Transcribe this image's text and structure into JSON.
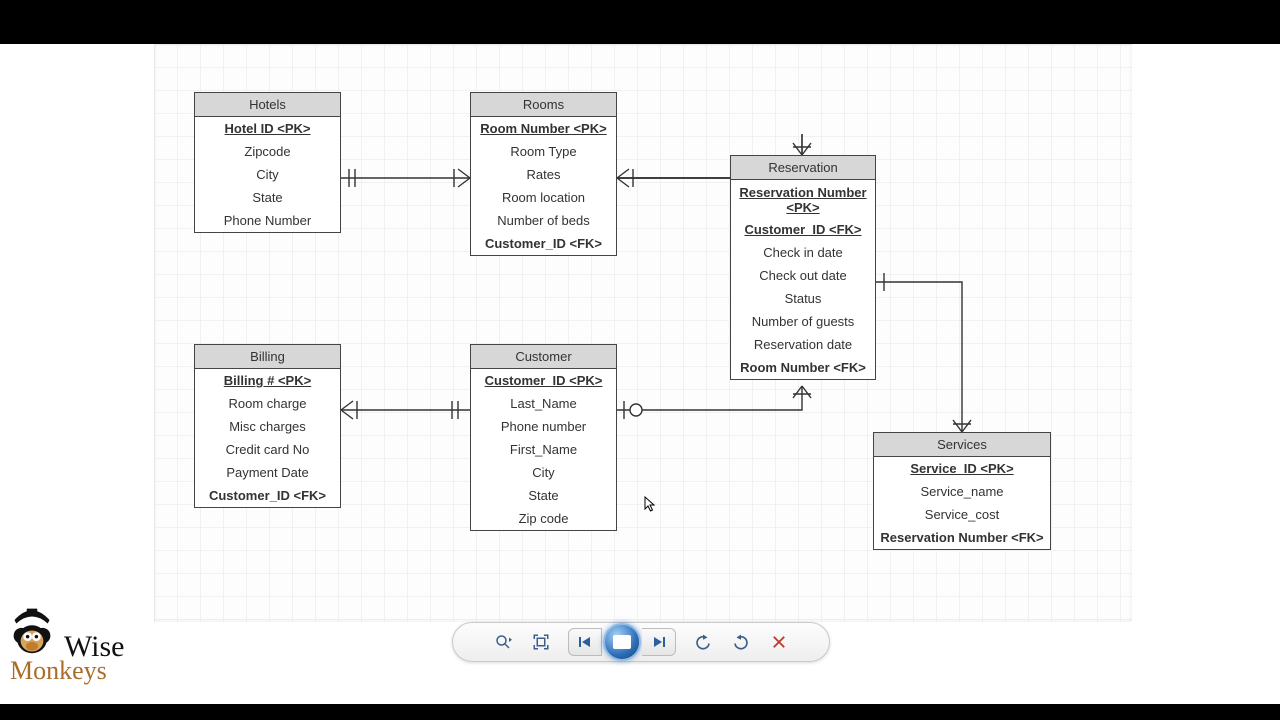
{
  "logo": {
    "line1": "Wise",
    "line2": "Monkeys"
  },
  "entities": {
    "hotels": {
      "title": "Hotels",
      "pk": "Hotel ID <PK>",
      "rows": [
        "Zipcode",
        "City",
        "State",
        "Phone Number"
      ]
    },
    "rooms": {
      "title": "Rooms",
      "pk": "Room Number <PK>",
      "rows": [
        "Room Type",
        "Rates",
        "Room location",
        "Number of beds"
      ],
      "fk": "Customer_ID <FK>"
    },
    "reservation": {
      "title": "Reservation",
      "pk1": "Reservation Number <PK>",
      "pk2": "Customer_ID <FK>",
      "rows": [
        "Check in date",
        "Check out date",
        "Status",
        "Number of guests",
        "Reservation date"
      ],
      "fk": "Room Number <FK>"
    },
    "billing": {
      "title": "Billing",
      "pk": "Billing # <PK>",
      "rows": [
        "Room charge",
        "Misc charges",
        "Credit card No",
        "Payment Date"
      ],
      "fk": "Customer_ID <FK>"
    },
    "customer": {
      "title": "Customer",
      "pk": "Customer_ID <PK>",
      "rows": [
        "Last_Name",
        "Phone number",
        "First_Name",
        "City",
        "State",
        "Zip code"
      ]
    },
    "services": {
      "title": "Services",
      "pk": "Service_ID <PK>",
      "rows": [
        "Service_name",
        "Service_cost"
      ],
      "fk": "Reservation Number <FK>"
    }
  },
  "toolbar": {
    "zoom": "zoom",
    "fit": "fit",
    "prev": "previous",
    "play": "play",
    "next": "next",
    "undo": "undo",
    "redo": "redo",
    "close": "close"
  }
}
